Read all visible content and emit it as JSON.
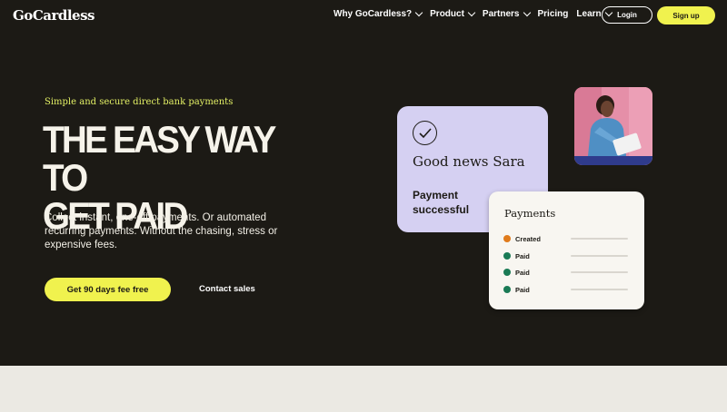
{
  "nav": {
    "logo": "GoCardless",
    "items": [
      {
        "label": "Why GoCardless?",
        "dropdown": true
      },
      {
        "label": "Product",
        "dropdown": true
      },
      {
        "label": "Partners",
        "dropdown": true
      },
      {
        "label": "Pricing",
        "dropdown": false
      },
      {
        "label": "Learn",
        "dropdown": true
      }
    ],
    "login_label": "Login",
    "signup_label": "Sign up"
  },
  "hero": {
    "eyebrow": "Simple and secure direct bank payments",
    "headline_line1": "THE EASY WAY TO",
    "headline_line2": "GET PAID",
    "subtext": "Collect instant, one-off payments. Or automated recurring payments. Without the chasing, stress or expensive fees.",
    "cta_label": "Get 90 days fee free",
    "contact_label": "Contact sales"
  },
  "notification_card": {
    "greeting": "Good news Sara",
    "status": "Payment successful"
  },
  "payments_card": {
    "title": "Payments",
    "rows": [
      {
        "status": "Created",
        "color": "#e07b1c"
      },
      {
        "status": "Paid",
        "color": "#1a7a55"
      },
      {
        "status": "Paid",
        "color": "#1a7a55"
      },
      {
        "status": "Paid",
        "color": "#1a7a55"
      }
    ]
  },
  "colors": {
    "background": "#1c1a15",
    "accent": "#f0f24e",
    "card_purple": "#d5d0f2",
    "photo_background": "#e58fa8"
  }
}
